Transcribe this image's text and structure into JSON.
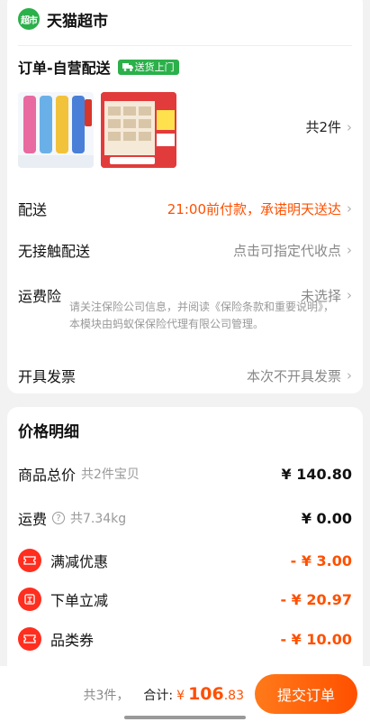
{
  "store": {
    "logo_text": "超市",
    "name": "天猫超市"
  },
  "order": {
    "title": "订单-自营配送",
    "delivery_tag": "送货上门"
  },
  "products": {
    "count_label": "共2件"
  },
  "rows": {
    "delivery": {
      "label": "配送",
      "value": "21:00前付款，承诺明天送达"
    },
    "contactless": {
      "label": "无接触配送",
      "value": "点击可指定代收点"
    },
    "insurance": {
      "label": "运费险",
      "value": "未选择",
      "notice": "请关注保险公司信息，并阅读《保险条款和重要说明》，本模块由蚂蚁保保险代理有限公司管理。"
    },
    "invoice": {
      "label": "开具发票",
      "value": "本次不开具发票"
    }
  },
  "price_detail": {
    "title": "价格明细",
    "goods_total": {
      "label": "商品总价",
      "sub": "共2件宝贝",
      "amount": "¥ 140.80"
    },
    "shipping": {
      "label": "运费",
      "sub": "共7.34kg",
      "amount": "¥ 0.00"
    },
    "full_reduction": {
      "label": "满减优惠",
      "amount": "- ¥ 3.00"
    },
    "order_discount": {
      "label": "下单立减",
      "amount": "- ¥ 20.97"
    },
    "category_coupon": {
      "label": "品类券",
      "amount": "- ¥ 10.00"
    }
  },
  "bottom": {
    "count": "共3件，",
    "total_label": "合计:",
    "currency": "¥",
    "total_int": "106",
    "total_dec": ".83",
    "submit_label": "提交订单"
  },
  "colors": {
    "accent": "#ff5000",
    "brand_green": "#2bb04a",
    "discount_red": "#ff2e1f"
  },
  "icons": [
    "truck-icon",
    "chevron-right-icon",
    "info-icon",
    "coupon-icon",
    "instant-discount-icon"
  ]
}
